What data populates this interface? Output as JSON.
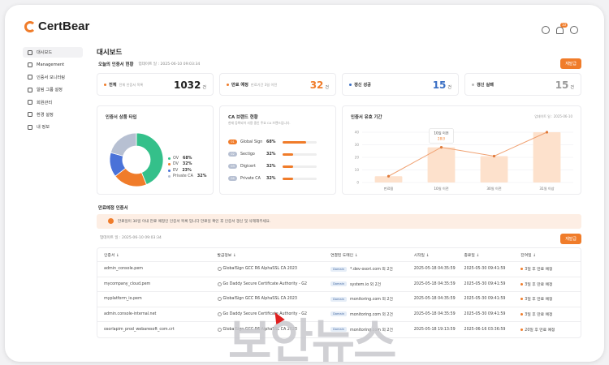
{
  "app": {
    "logo_text": "CertBear",
    "notification_count": "10"
  },
  "sidebar": {
    "items": [
      {
        "label": "대시보드",
        "icon": "grid-icon"
      },
      {
        "label": "Management",
        "icon": "group-icon"
      },
      {
        "label": "인증서 모니터링",
        "icon": "monitor-icon"
      },
      {
        "label": "알림 그룹 설정",
        "icon": "bell-group-icon"
      },
      {
        "label": "회원관리",
        "icon": "users-icon"
      },
      {
        "label": "환경 설정",
        "icon": "settings-icon"
      },
      {
        "label": "내 정보",
        "icon": "user-icon"
      }
    ]
  },
  "main": {
    "page_title": "대시보드",
    "today_title": "오늘의 인증서 현황",
    "updated": "업데이트 일 : 2025-06-10 09:03:34",
    "refresh_label": "재발급",
    "stats": [
      {
        "label": "전체",
        "desc": "전체 인증서 목록",
        "value": "1032",
        "unit": "건",
        "color": "#222222",
        "dot": "#f07c2a"
      },
      {
        "label": "만료 예정",
        "desc": "만료기간 3일 이전",
        "value": "32",
        "unit": "건",
        "color": "#f07c2a",
        "dot": "#f07c2a"
      },
      {
        "label": "갱신 성공",
        "desc": "",
        "value": "15",
        "unit": "건",
        "color": "#3a6fc4",
        "dot": "#3a6fc4"
      },
      {
        "label": "갱신 실패",
        "desc": "",
        "value": "15",
        "unit": "건",
        "color": "#999999",
        "dot": "#bbbbbb"
      }
    ],
    "product_panel_title": "인증서 상품 타입",
    "ca_panel_title": "CA 브랜드 현황",
    "ca_panel_desc": "현재 등록되어 사용 중인 주요 CA 브랜드입니다.",
    "ca_brands": [
      {
        "rank": "01",
        "name": "Global Sign",
        "pct": "68%",
        "value": 68,
        "color": "#f07c2a"
      },
      {
        "rank": "02",
        "name": "Sectigo",
        "pct": "32%",
        "value": 32,
        "color": "#f07c2a"
      },
      {
        "rank": "03",
        "name": "Digicert",
        "pct": "32%",
        "value": 32,
        "color": "#f07c2a"
      },
      {
        "rank": "04",
        "name": "Private CA",
        "pct": "32%",
        "value": 32,
        "color": "#f07c2a"
      }
    ],
    "validity_panel_title": "인증서 유효 기간",
    "validity_updated": "업데이트 일 : 2025-06-10",
    "expiring_title": "만료예정 인증서",
    "notice_text": "만료일이 30일 이내 만료 예정인 인증서 목록 입니다 만료일 확인 후 인증서 갱신 및 삭제해주세요.",
    "table_updated": "업데이트 일 : 2025-06-10 09:03:34",
    "table_refresh": "재발급",
    "table": {
      "headers": [
        "인증서 ↓",
        "발급정보 ↓",
        "연결된 도메인 ↓",
        "시작일 ↓",
        "종료일 ↓",
        "잔여일 ↓"
      ],
      "rows": [
        {
          "cert": "admin_console.pem",
          "issuer": "GlobalSign GCC R6 AlphaSSL CA 2023",
          "domain": "*.dev-osori.com 외 2건",
          "start": "2025-05-18 04:35:59",
          "end": "2025-05-30 09:41:59",
          "remaining": "3일 후 만료 예정"
        },
        {
          "cert": "mycompany_cloud.pem",
          "issuer": "Go Daddy Secure Certificate Authority - G2",
          "domain": "system.io 외 2건",
          "start": "2025-05-18 04:35:59",
          "end": "2025-05-30 09:41:59",
          "remaining": "3일 후 만료 예정"
        },
        {
          "cert": "myplatform_io.pem",
          "issuer": "GlobalSign GCC R6 AlphaSSL CA 2023",
          "domain": "monitoring.com 외 2건",
          "start": "2025-05-18 04:35:59",
          "end": "2025-05-30 09:41:59",
          "remaining": "3일 후 만료 예정"
        },
        {
          "cert": "admin.console-internal.net",
          "issuer": "Go Daddy Secure Certificate Authority - G2",
          "domain": "monitoring.com 외 2건",
          "start": "2025-05-18 04:35:59",
          "end": "2025-05-30 09:41:59",
          "remaining": "3일 후 만료 예정"
        },
        {
          "cert": "osorlapim_prod_webaresoft_com.crt",
          "issuer": "GlobalSign GCC R6 AlphaSSL CA 2023",
          "domain": "monitoring.com 외 2건",
          "start": "2025-05-18 19:13:59",
          "end": "2025-06-16 03:36:59",
          "remaining": "20일 후 만료 예정"
        }
      ],
      "domain_tag": "Domain"
    }
  },
  "watermark": "보안뉴스",
  "chart_data": [
    {
      "type": "pie",
      "categories": [
        "OV",
        "DV",
        "EV",
        "Private CA"
      ],
      "values": [
        68,
        32,
        23,
        32
      ],
      "labels": [
        "68%",
        "32%",
        "23%",
        "32%"
      ],
      "colors": [
        "#34c08a",
        "#f07c2a",
        "#4a72d8",
        "#b7c0d2"
      ],
      "donut": true,
      "legend": "right"
    },
    {
      "type": "bar",
      "categories": [
        "만료됨",
        "10일 이전",
        "30일 이전",
        "31일 이상"
      ],
      "values": [
        5,
        28,
        21,
        40
      ],
      "line_values": [
        5,
        28,
        21,
        40
      ],
      "ylim": [
        0,
        40
      ],
      "yticks": [
        "0",
        "10",
        "20",
        "30",
        "40"
      ],
      "grid": true,
      "tooltip": {
        "title": "10일 이전",
        "value": "28건"
      }
    }
  ]
}
